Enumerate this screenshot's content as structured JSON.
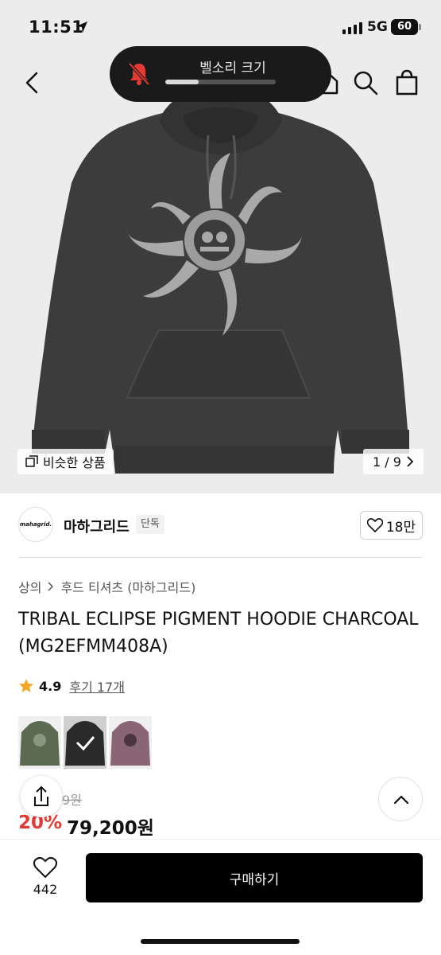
{
  "status_bar": {
    "time": "11:51",
    "network": "5G",
    "battery": "60"
  },
  "hud": {
    "title": "벨소리 크기",
    "volume_level": 0.3
  },
  "gallery": {
    "similar_label": "비슷한 상품",
    "page": "1 / 9"
  },
  "brand": {
    "logo_text": "mahagrid.",
    "name": "마하그리드",
    "tag": "단독",
    "likes": "18만"
  },
  "breadcrumb": {
    "category": "상의",
    "subcategory": "후드 티셔츠 (마하그리드)"
  },
  "product": {
    "title": "TRIBAL ECLIPSE PIGMENT HOODIE CHARCOAL(MG2EFMM408A)",
    "rating": "4.9",
    "reviews_label": "후기 17개",
    "swatches": [
      {
        "name": "green",
        "color": "#5b6b52"
      },
      {
        "name": "charcoal",
        "color": "#2a2a2a",
        "selected": true
      },
      {
        "name": "purple",
        "color": "#8a6575"
      }
    ],
    "original_price": "9원",
    "discount": "20%",
    "sale_price": "79,200원"
  },
  "bottom": {
    "heart_count": "442",
    "buy_label": "구매하기"
  },
  "colors": {
    "accent_red": "#e53935",
    "buy_button": "#000000",
    "star": "#f5a623"
  }
}
